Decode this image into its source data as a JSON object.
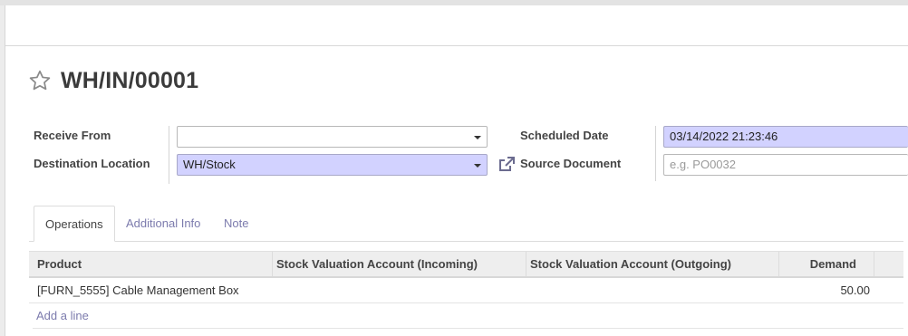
{
  "record": {
    "title": "WH/IN/00001"
  },
  "form": {
    "receive_from_label": "Receive From",
    "receive_from_value": "",
    "destination_label": "Destination Location",
    "destination_value": "WH/Stock",
    "scheduled_date_label": "Scheduled Date",
    "scheduled_date_value": "03/14/2022 21:23:46",
    "source_document_label": "Source Document",
    "source_document_placeholder": "e.g. PO0032",
    "source_document_value": ""
  },
  "tabs": [
    {
      "label": "Operations",
      "active": true
    },
    {
      "label": "Additional Info",
      "active": false
    },
    {
      "label": "Note",
      "active": false
    }
  ],
  "table": {
    "columns": [
      "Product",
      "Stock Valuation Account (Incoming)",
      "Stock Valuation Account (Outgoing)",
      "Demand"
    ],
    "rows": [
      {
        "product": "[FURN_5555] Cable Management Box",
        "incoming": "",
        "outgoing": "",
        "demand": "50.00"
      }
    ],
    "add_line_label": "Add a line"
  },
  "colors": {
    "accent": "#7c7bad",
    "required_field_bg": "#d2d2ff"
  },
  "icons": {
    "favorite": "star-outline-icon",
    "dropdown": "caret-down-icon",
    "external": "external-link-icon"
  }
}
